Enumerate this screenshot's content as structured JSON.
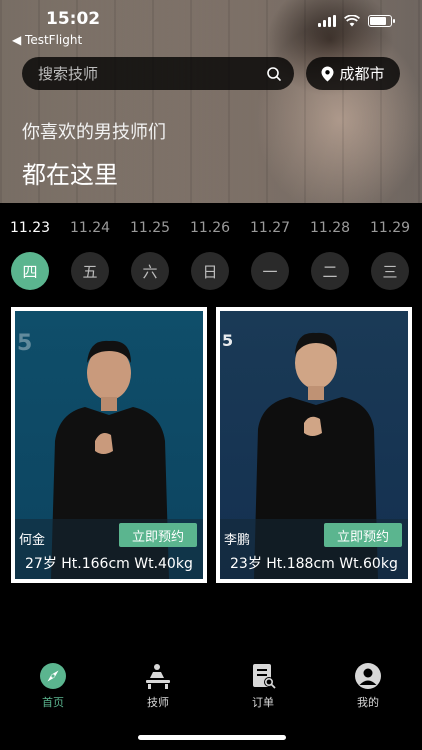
{
  "status": {
    "time": "15:02",
    "back_label": "◀ TestFlight"
  },
  "search": {
    "placeholder": "搜索技师"
  },
  "location": {
    "city": "成都市"
  },
  "banner": {
    "line1": "你喜欢的男技师们",
    "line2": "都在这里"
  },
  "days": [
    {
      "date": "11.23",
      "weekday": "四",
      "active": true
    },
    {
      "date": "11.24",
      "weekday": "五",
      "active": false
    },
    {
      "date": "11.25",
      "weekday": "六",
      "active": false
    },
    {
      "date": "11.26",
      "weekday": "日",
      "active": false
    },
    {
      "date": "11.27",
      "weekday": "一",
      "active": false
    },
    {
      "date": "11.28",
      "weekday": "二",
      "active": false
    },
    {
      "date": "11.29",
      "weekday": "三",
      "active": false
    }
  ],
  "therapists": [
    {
      "name": "何金",
      "book_label": "立即预约",
      "stats": "27岁 Ht.166cm Wt.40kg",
      "logo": "5"
    },
    {
      "name": "李鹏",
      "book_label": "立即预约",
      "stats": "23岁 Ht.188cm Wt.60kg",
      "logo": "5"
    }
  ],
  "tabs": [
    {
      "label": "首页",
      "icon": "compass-icon",
      "active": true
    },
    {
      "label": "技师",
      "icon": "massage-icon",
      "active": false
    },
    {
      "label": "订单",
      "icon": "order-list-icon",
      "active": false
    },
    {
      "label": "我的",
      "icon": "user-icon",
      "active": false
    }
  ],
  "colors": {
    "accent": "#5bb58f",
    "background": "#000000",
    "card_border": "#ffffff"
  }
}
